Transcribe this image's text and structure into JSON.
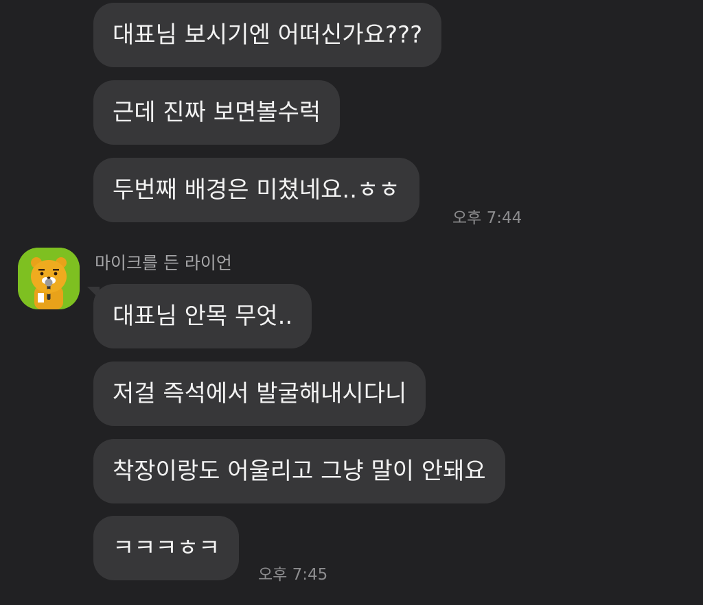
{
  "chat": {
    "sent_group": {
      "messages": [
        {
          "text": "대표님 보시기엔 어떠신가요???"
        },
        {
          "text": "근데 진짜 보면볼수럭"
        },
        {
          "text": "두번째 배경은 미쳤네요..ㅎㅎ"
        }
      ],
      "time": "오후 7:44"
    },
    "received_group": {
      "sender": {
        "name": "마이크를 든 라이언",
        "avatar_icon": "lion-with-microphone-icon",
        "avatar_bg": "#7ec021"
      },
      "messages": [
        {
          "text": "대표님 안목 무엇.."
        },
        {
          "text": "저걸 즉석에서 발굴해내시다니"
        },
        {
          "text": "착장이랑도 어울리고 그냥 말이 안돼요"
        },
        {
          "text": "ㅋㅋㅋㅎㅋ"
        }
      ],
      "time": "오후 7:45"
    }
  },
  "colors": {
    "background": "#212123",
    "bubble": "#373739",
    "bubble_text": "#f2f2f2",
    "meta_text": "#8c8c8e"
  }
}
